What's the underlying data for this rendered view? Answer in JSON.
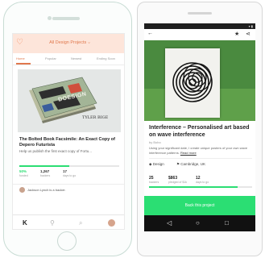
{
  "ios": {
    "nav_title": "All Design Projects",
    "tabs": [
      "Home",
      "Popular",
      "Newest",
      "Ending Soon"
    ],
    "project": {
      "cover_text": "DOESIGN",
      "cover_caption": "TYLER BIGE",
      "title": "The Bolted Book Facsimile: An Exact Copy of Depero Futurista",
      "description": "Help us publish the first exact copy of Fortu...",
      "funded_pct": 0.5,
      "stats": [
        {
          "value": "50%",
          "label": "funded"
        },
        {
          "value": "1,267",
          "label": "backers"
        },
        {
          "value": "17",
          "label": "days to go"
        }
      ]
    },
    "backer_text": "Jackson Lynch is a backer."
  },
  "android": {
    "title": "Interference – Personalised art based on wave interference",
    "creator": "by Bobo",
    "description": "Using your significant date, I create unique posters of your own wave interference patterns.",
    "read_more": "Read more",
    "tags": [
      "Design",
      "Cambridge, UK"
    ],
    "stats": [
      {
        "value": "25",
        "label": "backers"
      },
      {
        "value": "$863",
        "label": "pledged of $1k"
      },
      {
        "value": "12",
        "label": "days to go"
      }
    ],
    "funded_pct": 0.86,
    "cta": "Back this project"
  }
}
